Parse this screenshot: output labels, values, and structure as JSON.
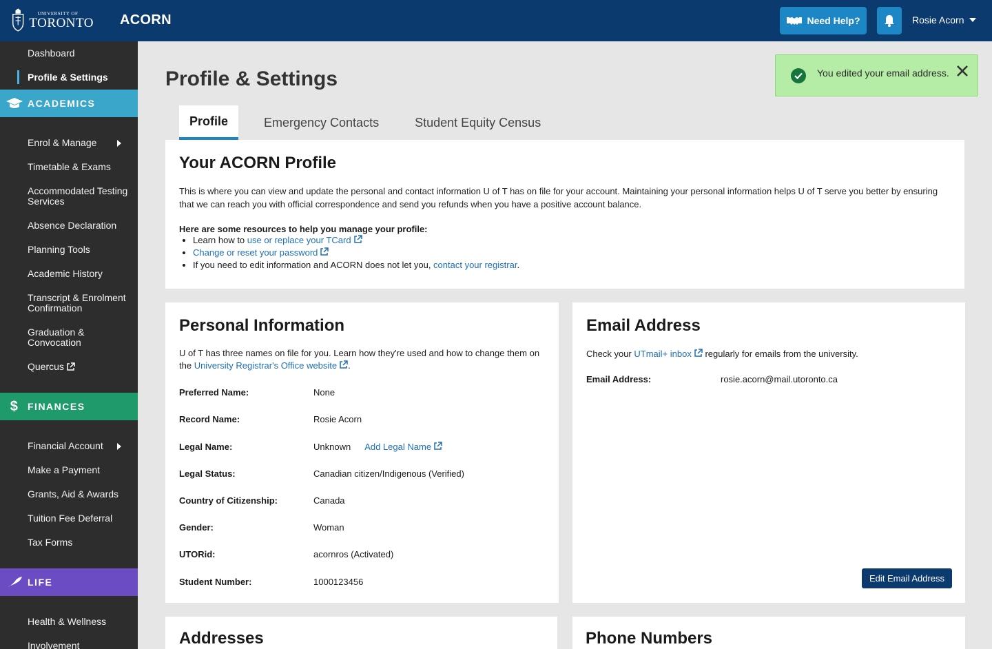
{
  "header": {
    "logo_small": "UNIVERSITY OF",
    "logo_big": "TORONTO",
    "app_name": "ACORN",
    "help_label": "Need Help?",
    "user_name": "Rosie Acorn"
  },
  "sidebar": {
    "top_items": [
      {
        "label": "Dashboard"
      },
      {
        "label": "Profile & Settings",
        "active": true
      }
    ],
    "academics": {
      "title": "ACADEMICS",
      "items": [
        "Enrol & Manage",
        "Timetable & Exams",
        "Accommodated Testing Services",
        "Absence Declaration",
        "Planning Tools",
        "Academic History",
        "Transcript & Enrolment Confirmation",
        "Graduation & Convocation",
        "Quercus"
      ]
    },
    "finances": {
      "title": "FINANCES",
      "items": [
        "Financial Account",
        "Make a Payment",
        "Grants, Aid & Awards",
        "Tuition Fee Deferral",
        "Tax Forms"
      ]
    },
    "life": {
      "title": "LIFE",
      "items": [
        "Health & Wellness",
        "Involvement"
      ]
    },
    "colors": {
      "academics": "#3aa6c9",
      "finances": "#1f9a6a",
      "life": "#6b4cc2"
    }
  },
  "page": {
    "title": "Profile & Settings",
    "tabs": [
      "Profile",
      "Emergency Contacts",
      "Student Equity Census"
    ]
  },
  "profile": {
    "heading": "Your ACORN Profile",
    "description": "This is where you can view and update the personal and contact information U of T has on file for your account. Maintaining your personal information helps U of T serve you better by ensuring that we can reach you with official correspondence and send you refunds when you have a positive account balance.",
    "resources_title": "Here are some resources to help you manage your profile:",
    "res1_prefix": "Learn how to ",
    "res1_link": "use or replace your TCard",
    "res2_link": "Change or reset your password",
    "res3_prefix": "If you need to edit information and ACORN does not let you, ",
    "res3_link": "contact your registrar",
    "res3_suffix": "."
  },
  "personal": {
    "heading": "Personal Information",
    "intro_prefix": "U of T has three names on file for you. Learn how they're used and how to change them on the ",
    "intro_link": "University Registrar's Office website",
    "intro_suffix": ".",
    "rows": [
      {
        "label": "Preferred Name:",
        "value": "None"
      },
      {
        "label": "Record Name:",
        "value": "Rosie Acorn"
      },
      {
        "label": "Legal Name:",
        "value": "Unknown",
        "link": "Add Legal Name"
      },
      {
        "label": "Legal Status:",
        "value": "Canadian citizen/Indigenous (Verified)"
      },
      {
        "label": "Country of Citizenship:",
        "value": "Canada"
      },
      {
        "label": "Gender:",
        "value": "Woman"
      },
      {
        "label": "UTORid:",
        "value": "acornros (Activated)"
      },
      {
        "label": "Student Number:",
        "value": "1000123456"
      }
    ]
  },
  "email": {
    "heading": "Email Address",
    "intro_prefix": "Check your ",
    "intro_link": "UTmail+ inbox",
    "intro_suffix": " regularly for emails from the university.",
    "label": "Email Address:",
    "value": "rosie.acorn@mail.utoronto.ca",
    "edit_label": "Edit Email Address"
  },
  "addresses": {
    "heading": "Addresses"
  },
  "phones": {
    "heading": "Phone Numbers"
  },
  "toast": {
    "message": "You edited your email address."
  }
}
